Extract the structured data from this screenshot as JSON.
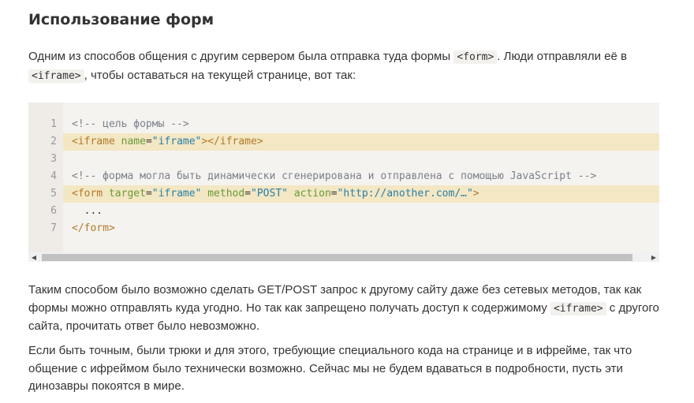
{
  "heading": "Использование форм",
  "intro": {
    "part1": "Одним из способов общения с другим сервером была отправка туда формы ",
    "code1": "<form>",
    "part2": ". Люди отправляли её в ",
    "code2": "<iframe>",
    "part3": ", чтобы оставаться на текущей странице, вот так:"
  },
  "code": {
    "line_numbers": [
      "1",
      "2",
      "3",
      "4",
      "5",
      "6",
      "7"
    ],
    "line1": {
      "comment": "<!-- цель формы -->"
    },
    "line2": {
      "open": "<iframe",
      "attr": "name",
      "eq": "=",
      "value": "\"iframe\"",
      "close": "></iframe>"
    },
    "line4": {
      "comment": "<!-- форма могла быть динамически сгенерирована и отправлена с помощью JavaScript -->"
    },
    "line5": {
      "open": "<form",
      "attr1": "target",
      "val1": "\"iframe\"",
      "attr2": "method",
      "val2": "\"POST\"",
      "attr3": "action",
      "val3": "\"http://another.com/…\"",
      "close": ">"
    },
    "line6": {
      "text": "  ..."
    },
    "line7": {
      "close": "</form>"
    },
    "highlighted_lines": [
      2,
      5
    ]
  },
  "para2": {
    "part1": "Таким способом было возможно сделать GET/POST запрос к другому сайту даже без сетевых методов, так как формы можно отправлять куда угодно. Но так как запрещено получать доступ к содержимому ",
    "code": "<iframe>",
    "part2": " с другого сайта, прочитать ответ было невозможно."
  },
  "para3": "Если быть точным, были трюки и для этого, требующие специального кода на странице и в ифрейме, так что общение с ифреймом было технически возможно. Сейчас мы не будем вдаваться в подробности, пусть эти динозавры покоятся в мире.",
  "scrollbar": {
    "left_arrow_icon": "triangle-left-icon",
    "right_arrow_icon": "triangle-right-icon",
    "left_glyph": "◀",
    "right_glyph": "▶"
  },
  "colors": {
    "highlight_line": "#f3e7c4",
    "code_background": "#f5f3f0",
    "comment": "#7a8189",
    "tag": "#b07a2a",
    "attribute": "#6a9a3a",
    "string": "#2a7fa6"
  }
}
